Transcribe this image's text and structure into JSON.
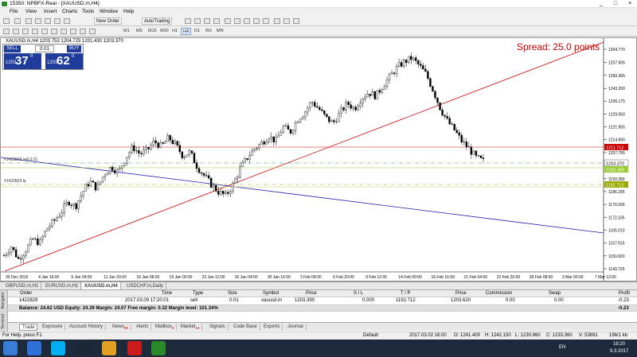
{
  "window": {
    "title": "15350: NPBFX-Real - [XAUUSD.m,H4]",
    "min": "_",
    "max": "□",
    "close": "×"
  },
  "menu": [
    "File",
    "View",
    "Insert",
    "Charts",
    "Tools",
    "Window",
    "Help"
  ],
  "toolbar": {
    "new_order": "New Order",
    "autotrading": "AutoTrading",
    "timeframes": [
      "M1",
      "M5",
      "M15",
      "M30",
      "H1",
      "H4",
      "D1",
      "W1",
      "MN"
    ],
    "active_tf": "H4"
  },
  "chart": {
    "info": "XAUUSD.m,H4  1203.753 1204.725 1201.430 1203.370",
    "spread": "Spread: 25.0 points",
    "trade_panel": {
      "sell": "SELL",
      "buy": "BUY",
      "lot": "0.01",
      "sell_small": "1203",
      "sell_big": "37",
      "sell_sup": "0",
      "buy_small": "1203",
      "buy_big": "62",
      "buy_sup": "0"
    },
    "order_label": "#1422829 sell 0.01",
    "tp_label": "#1422829 tp",
    "price_ticks": [
      "1264.770",
      "1257.605",
      "1250.365",
      "1243.200",
      "1236.175",
      "1229.050",
      "1221.955",
      "1214.890",
      "1207.795",
      "1200.480",
      "1193.390",
      "1186.295",
      "1179.200",
      "1172.105",
      "1165.010",
      "1157.915",
      "1150.820",
      "1143.725"
    ],
    "price_tags": {
      "red": "1211.712",
      "current": "1203.370",
      "green": "1200.390",
      "tp": "1192.712"
    },
    "date_ticks": [
      "30 Dec 2016",
      "4 Jan 16:00",
      "9 Jan 04:00",
      "11 Jan 20:00",
      "16 Jan 08:00",
      "19 Jan 00:00",
      "23 Jan 12:00",
      "26 Jan 04:00",
      "30 Jan 16:00",
      "2 Feb 08:00",
      "6 Feb 20:00",
      "9 Feb 12:00",
      "14 Feb 00:00",
      "16 Feb 16:00",
      "21 Feb 04:00",
      "23 Feb 20:00",
      "28 Feb 08:00",
      "3 Mar 00:00",
      "7 Mar 12:00"
    ],
    "series_close": [
      1151,
      1156,
      1149,
      1154,
      1160,
      1158,
      1166,
      1170,
      1175,
      1181,
      1178,
      1186,
      1192,
      1188,
      1196,
      1200,
      1197,
      1205,
      1211,
      1207,
      1209,
      1214,
      1211,
      1216,
      1212,
      1206,
      1208,
      1200,
      1195,
      1190,
      1186,
      1184,
      1190,
      1199,
      1205,
      1210,
      1213,
      1217,
      1214,
      1222,
      1219,
      1226,
      1230,
      1236,
      1232,
      1227,
      1224,
      1230,
      1235,
      1232,
      1238,
      1241,
      1239,
      1245,
      1250,
      1255,
      1258,
      1260,
      1256,
      1251,
      1242,
      1232,
      1225,
      1220,
      1214,
      1210,
      1205,
      1203
    ]
  },
  "chart_tabs": [
    "GBPUSD.m,H1",
    "EURUSD.m,H1",
    "XAUUSD.m,H4",
    "USDCHF.m,Daily"
  ],
  "active_chart_tab": "XAUUSD.m,H4",
  "terminal": {
    "side_labels": [
      "Terminal",
      "Navigator"
    ],
    "headers": [
      "Order",
      "Time",
      "Type",
      "Size",
      "Symbol",
      "Price",
      "S / L",
      "T / P",
      "Price",
      "Commission",
      "Swap",
      "Profit"
    ],
    "row": [
      "1422829",
      "2017.03.09 17:20:01",
      "sell",
      "0.01",
      "xauusd.m",
      "1203.390",
      "0.000",
      "1192.712",
      "1203.620",
      "0.00",
      "0.00",
      "-0.23"
    ],
    "balance": "Balance: 24.62 USD  Equity: 24.39  Margin: 24.07  Free margin: 0.32  Margin level: 101.34%",
    "balance_profit": "-0.23",
    "tabs": [
      "Trade",
      "Exposure",
      "Account History",
      "News",
      "Alerts",
      "Mailbox",
      "Market",
      "Signals",
      "Code Base",
      "Experts",
      "Journal"
    ],
    "badges": {
      "News": "99",
      "Mailbox": "6",
      "Market": "13"
    },
    "active_tab": "Trade"
  },
  "status": {
    "help": "For Help, press F1",
    "profile": "Default",
    "time": "2017.03.02 16:00",
    "o": "O: 1241.400",
    "h": "H: 1242.150",
    "l": "L: 1230.960",
    "c": "C: 1233.360",
    "v": "V: 53691",
    "conn": "196/1 kb"
  },
  "taskbar": {
    "lang": "EN",
    "clock": "18:20",
    "date": "9.3.2017"
  },
  "colors": {
    "accent": "#1f3c9a",
    "red_line": "#cc0000",
    "green_line": "#66aa00",
    "blue_line": "#2222aa"
  }
}
